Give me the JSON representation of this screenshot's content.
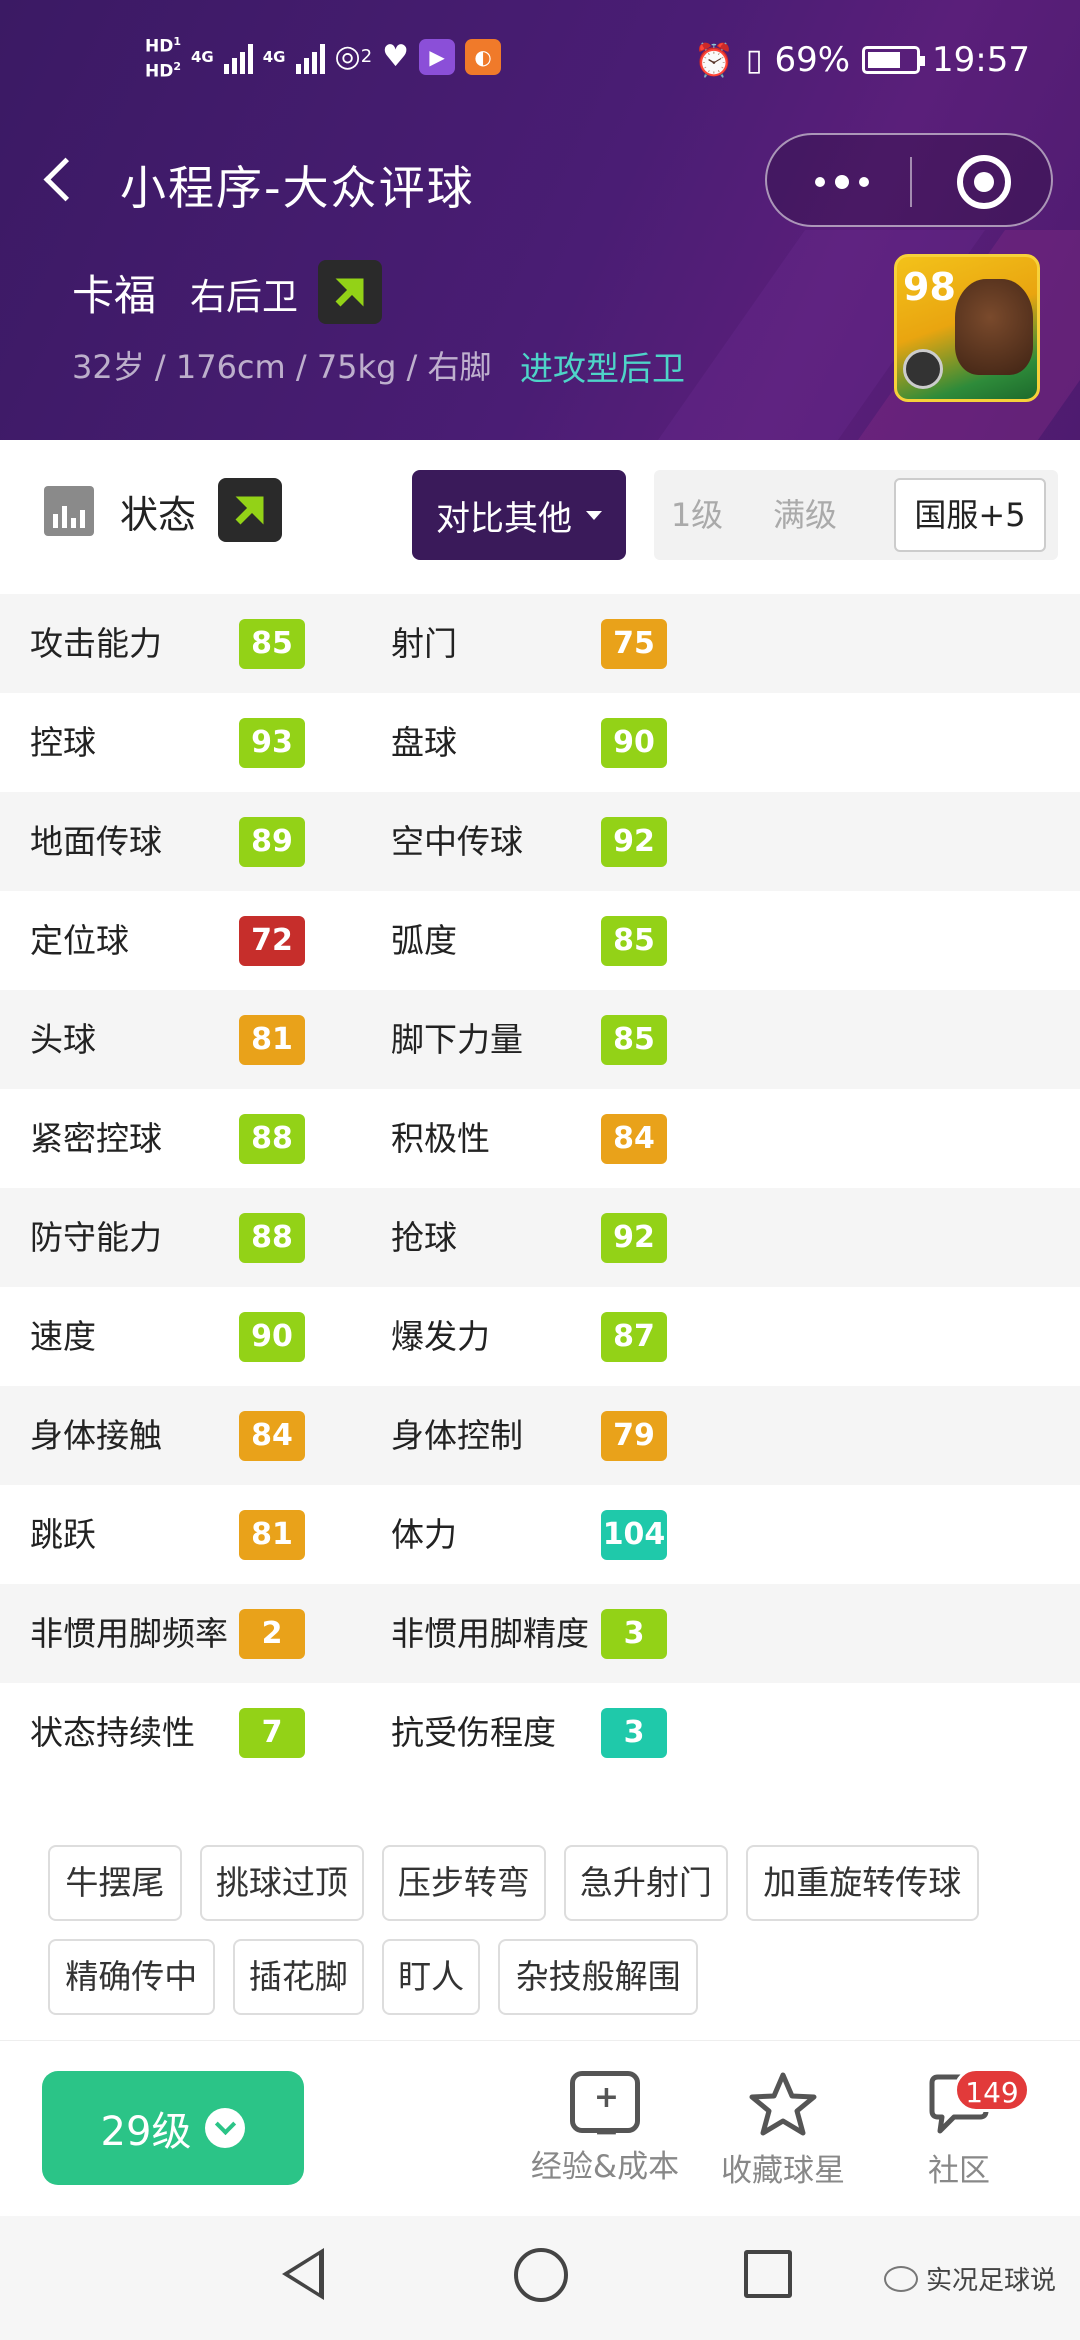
{
  "status_bar": {
    "hd1": "HD",
    "hd1_sub": "1",
    "hd2": "HD",
    "hd2_sub": "2",
    "net1": "4G",
    "net2": "4G",
    "hotspot_count": "2",
    "battery_percent": "69%",
    "time": "19:57",
    "battery_level": 0.69
  },
  "nav": {
    "title": "小程序-大众评球"
  },
  "player": {
    "name": "卡福",
    "position": "右后卫",
    "info": "32岁 / 176cm / 75kg / 右脚",
    "style": "进攻型后卫",
    "card_rating": "98"
  },
  "section": {
    "title": "状态",
    "compare_label": "对比其他",
    "level_options": [
      "1级",
      "满级",
      "国服+5"
    ],
    "selected_level": "国服+5"
  },
  "colors": {
    "green": "#93d217",
    "orange": "#e9a21a",
    "red": "#c62e2b",
    "teal": "#1fc9aa",
    "purple_header": "#4a1d74",
    "compare_btn": "#3a1a5a",
    "level_btn": "#2bc487"
  },
  "attributes": [
    {
      "left": {
        "name": "攻击能力",
        "value": "85",
        "color": "green"
      },
      "right": {
        "name": "射门",
        "value": "75",
        "color": "orange"
      }
    },
    {
      "left": {
        "name": "控球",
        "value": "93",
        "color": "green"
      },
      "right": {
        "name": "盘球",
        "value": "90",
        "color": "green"
      }
    },
    {
      "left": {
        "name": "地面传球",
        "value": "89",
        "color": "green"
      },
      "right": {
        "name": "空中传球",
        "value": "92",
        "color": "green"
      }
    },
    {
      "left": {
        "name": "定位球",
        "value": "72",
        "color": "red"
      },
      "right": {
        "name": "弧度",
        "value": "85",
        "color": "green"
      }
    },
    {
      "left": {
        "name": "头球",
        "value": "81",
        "color": "orange"
      },
      "right": {
        "name": "脚下力量",
        "value": "85",
        "color": "green"
      }
    },
    {
      "left": {
        "name": "紧密控球",
        "value": "88",
        "color": "green"
      },
      "right": {
        "name": "积极性",
        "value": "84",
        "color": "orange"
      }
    },
    {
      "left": {
        "name": "防守能力",
        "value": "88",
        "color": "green"
      },
      "right": {
        "name": "抢球",
        "value": "92",
        "color": "green"
      }
    },
    {
      "left": {
        "name": "速度",
        "value": "90",
        "color": "green"
      },
      "right": {
        "name": "爆发力",
        "value": "87",
        "color": "green"
      }
    },
    {
      "left": {
        "name": "身体接触",
        "value": "84",
        "color": "orange"
      },
      "right": {
        "name": "身体控制",
        "value": "79",
        "color": "orange"
      }
    },
    {
      "left": {
        "name": "跳跃",
        "value": "81",
        "color": "orange"
      },
      "right": {
        "name": "体力",
        "value": "104",
        "color": "teal"
      }
    },
    {
      "left": {
        "name": "非惯用脚频率",
        "value": "2",
        "color": "orange"
      },
      "right": {
        "name": "非惯用脚精度",
        "value": "3",
        "color": "green"
      }
    },
    {
      "left": {
        "name": "状态持续性",
        "value": "7",
        "color": "green"
      },
      "right": {
        "name": "抗受伤程度",
        "value": "3",
        "color": "teal"
      }
    }
  ],
  "skills": [
    "牛摆尾",
    "挑球过顶",
    "压步转弯",
    "急升射门",
    "加重旋转传球",
    "精确传中",
    "插花脚",
    "盯人",
    "杂技般解围"
  ],
  "bottom_bar": {
    "level_label": "29级",
    "tabs": [
      {
        "label": "经验&成本",
        "icon": "calculator-icon"
      },
      {
        "label": "收藏球星",
        "icon": "star-icon"
      },
      {
        "label": "社区",
        "icon": "chat-bubble-icon"
      }
    ],
    "community_badge": "149"
  },
  "watermark": "实况足球说"
}
